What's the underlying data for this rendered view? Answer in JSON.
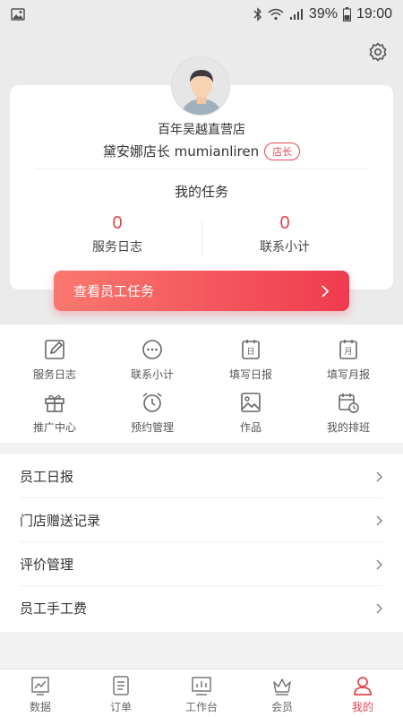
{
  "status_bar": {
    "left_icon": "image-icon",
    "battery_text": "39%",
    "time": "19:00",
    "icons": [
      "bluetooth-icon",
      "wifi-icon",
      "signal-icon",
      "battery-icon"
    ]
  },
  "profile": {
    "store_name": "百年吴越直营店",
    "user_line": "黛安娜店长 mumianliren",
    "role_badge": "店长"
  },
  "tasks": {
    "title": "我的任务",
    "service_log_count": "0",
    "service_log_label": "服务日志",
    "contact_count": "0",
    "contact_label": "联系小计",
    "view_button": "查看员工任务"
  },
  "grid": [
    {
      "label": "服务日志",
      "icon": "edit-icon"
    },
    {
      "label": "联系小计",
      "icon": "chat-icon"
    },
    {
      "label": "填写日报",
      "icon": "daily-report-icon"
    },
    {
      "label": "填写月报",
      "icon": "monthly-report-icon"
    },
    {
      "label": "推广中心",
      "icon": "gift-icon"
    },
    {
      "label": "预约管理",
      "icon": "alarm-clock-icon"
    },
    {
      "label": "作品",
      "icon": "picture-icon"
    },
    {
      "label": "我的排班",
      "icon": "schedule-icon"
    }
  ],
  "menu": [
    {
      "label": "员工日报"
    },
    {
      "label": "门店赠送记录"
    },
    {
      "label": "评价管理"
    },
    {
      "label": "员工手工费"
    }
  ],
  "tab_bar": [
    {
      "label": "数据",
      "icon": "chart-icon"
    },
    {
      "label": "订单",
      "icon": "order-icon"
    },
    {
      "label": "工作台",
      "icon": "workbench-icon"
    },
    {
      "label": "会员",
      "icon": "crown-icon"
    },
    {
      "label": "我的",
      "icon": "person-icon",
      "active": true
    }
  ],
  "colors": {
    "accent": "#e2474f",
    "button_gradient_start": "#f9786e",
    "button_gradient_end": "#f03b4f",
    "background": "#f2f2f2"
  }
}
